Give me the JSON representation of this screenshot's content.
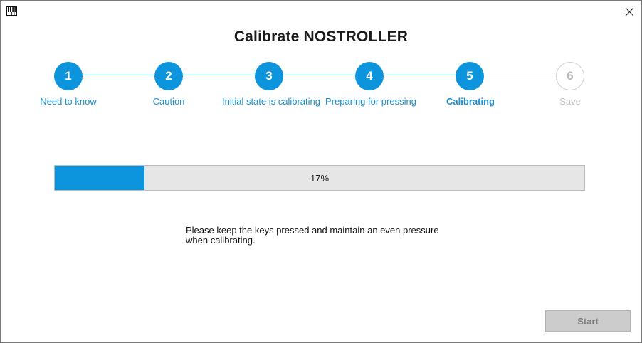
{
  "window": {
    "title": "Calibrate NOSTROLLER",
    "app_icon": "piano-keyboard-icon",
    "close_icon": "close-icon"
  },
  "colors": {
    "accent": "#0c94dc",
    "label_active": "#1b8fd0",
    "label_inactive": "#c4c4c4",
    "disabled_button": "#cccccc"
  },
  "steps": [
    {
      "number": "1",
      "label": "Need to know",
      "state": "done"
    },
    {
      "number": "2",
      "label": "Caution",
      "state": "done"
    },
    {
      "number": "3",
      "label": "Initial state is calibrating",
      "state": "done"
    },
    {
      "number": "4",
      "label": "Preparing for pressing",
      "state": "done"
    },
    {
      "number": "5",
      "label": "Calibrating",
      "state": "current"
    },
    {
      "number": "6",
      "label": "Save",
      "state": "pending"
    }
  ],
  "progress": {
    "percent": 17,
    "label": "17%"
  },
  "instructions": "Please keep the keys pressed and maintain an even pressure when calibrating.",
  "buttons": {
    "start": "Start",
    "start_enabled": false
  }
}
